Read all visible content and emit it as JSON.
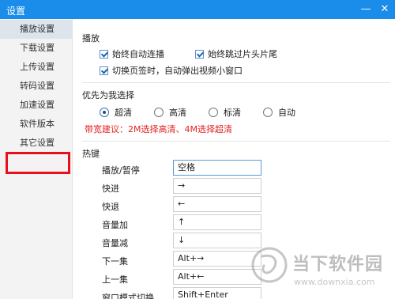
{
  "window": {
    "title": "设置",
    "minimize_glyph": "—",
    "close_glyph": "✕"
  },
  "sidebar": {
    "items": [
      {
        "label": "播放设置"
      },
      {
        "label": "下载设置"
      },
      {
        "label": "上传设置"
      },
      {
        "label": "转码设置"
      },
      {
        "label": "加速设置"
      },
      {
        "label": "软件版本"
      },
      {
        "label": "其它设置"
      }
    ],
    "active_index": 0,
    "highlighted_index": 6,
    "highlight_color": "#e8101d"
  },
  "playback": {
    "section_title": "播放",
    "options": [
      {
        "label": "始终自动连播",
        "checked": true
      },
      {
        "label": "始终跳过片头片尾",
        "checked": true
      },
      {
        "label": "切换页签时，自动弹出视频小窗口",
        "checked": true
      }
    ]
  },
  "quality": {
    "section_title": "优先为我选择",
    "options": [
      {
        "label": "超清",
        "selected": true
      },
      {
        "label": "高清",
        "selected": false
      },
      {
        "label": "标清",
        "selected": false
      },
      {
        "label": "自动",
        "selected": false
      }
    ],
    "hint": "带宽建议：2M选择高清、4M选择超清",
    "hint_color": "#e42121"
  },
  "hotkeys": {
    "section_title": "热键",
    "rows": [
      {
        "label": "播放/暂停",
        "value": "空格"
      },
      {
        "label": "快进",
        "value": "→"
      },
      {
        "label": "快退",
        "value": "←"
      },
      {
        "label": "音量加",
        "value": "↑"
      },
      {
        "label": "音量减",
        "value": "↓"
      },
      {
        "label": "下一集",
        "value": "Alt+→"
      },
      {
        "label": "上一集",
        "value": "Alt+←"
      },
      {
        "label": "窗口模式切换",
        "value": "Shift+Enter"
      }
    ]
  },
  "watermark": {
    "name": "当下软件园",
    "url": "www.downxia.com",
    "logo_icon": "downxia-logo-icon"
  },
  "colors": {
    "titlebar": "#1a8cea",
    "sidebar_bg": "#f3f3f3",
    "active_item_bg": "#dde4ec"
  }
}
